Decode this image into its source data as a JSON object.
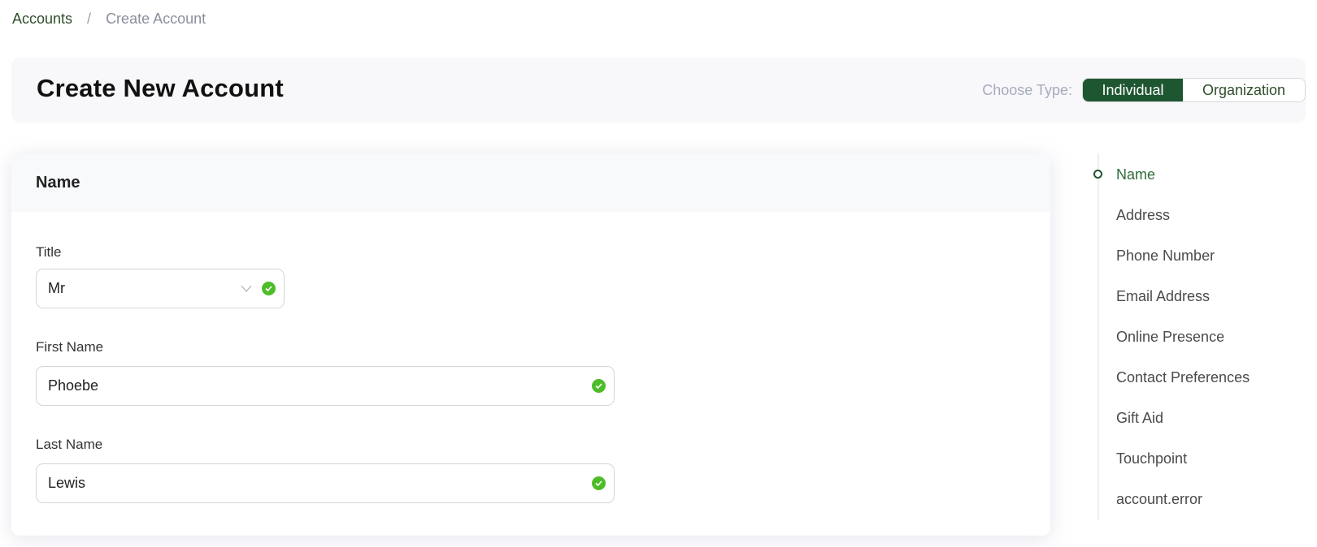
{
  "breadcrumb": {
    "items": [
      {
        "label": "Accounts",
        "link": true
      },
      {
        "label": "Create Account",
        "link": false
      }
    ],
    "separator": "/"
  },
  "header": {
    "title": "Create New Account",
    "choose_type_label": "Choose Type:",
    "types": [
      {
        "label": "Individual",
        "selected": true
      },
      {
        "label": "Organization",
        "selected": false
      }
    ]
  },
  "colors": {
    "brand_green": "#1e5631",
    "valid_green": "#4dbd2a",
    "panel_bg": "#f8f8fa"
  },
  "form": {
    "section_title": "Name",
    "fields": [
      {
        "label": "Title",
        "type": "select",
        "value": "Mr",
        "valid": true,
        "icons": [
          "chevron-down-icon",
          "check-circle-icon"
        ]
      },
      {
        "label": "First Name",
        "type": "text",
        "value": "Phoebe",
        "valid": true,
        "icons": [
          "check-circle-icon"
        ]
      },
      {
        "label": "Last Name",
        "type": "text",
        "value": "Lewis",
        "valid": true,
        "icons": [
          "check-circle-icon"
        ]
      }
    ]
  },
  "section_nav": {
    "active_index": 0,
    "items": [
      {
        "label": "Name"
      },
      {
        "label": "Address"
      },
      {
        "label": "Phone Number"
      },
      {
        "label": "Email Address"
      },
      {
        "label": "Online Presence"
      },
      {
        "label": "Contact Preferences"
      },
      {
        "label": "Gift Aid"
      },
      {
        "label": "Touchpoint"
      },
      {
        "label": "account.error"
      }
    ]
  }
}
